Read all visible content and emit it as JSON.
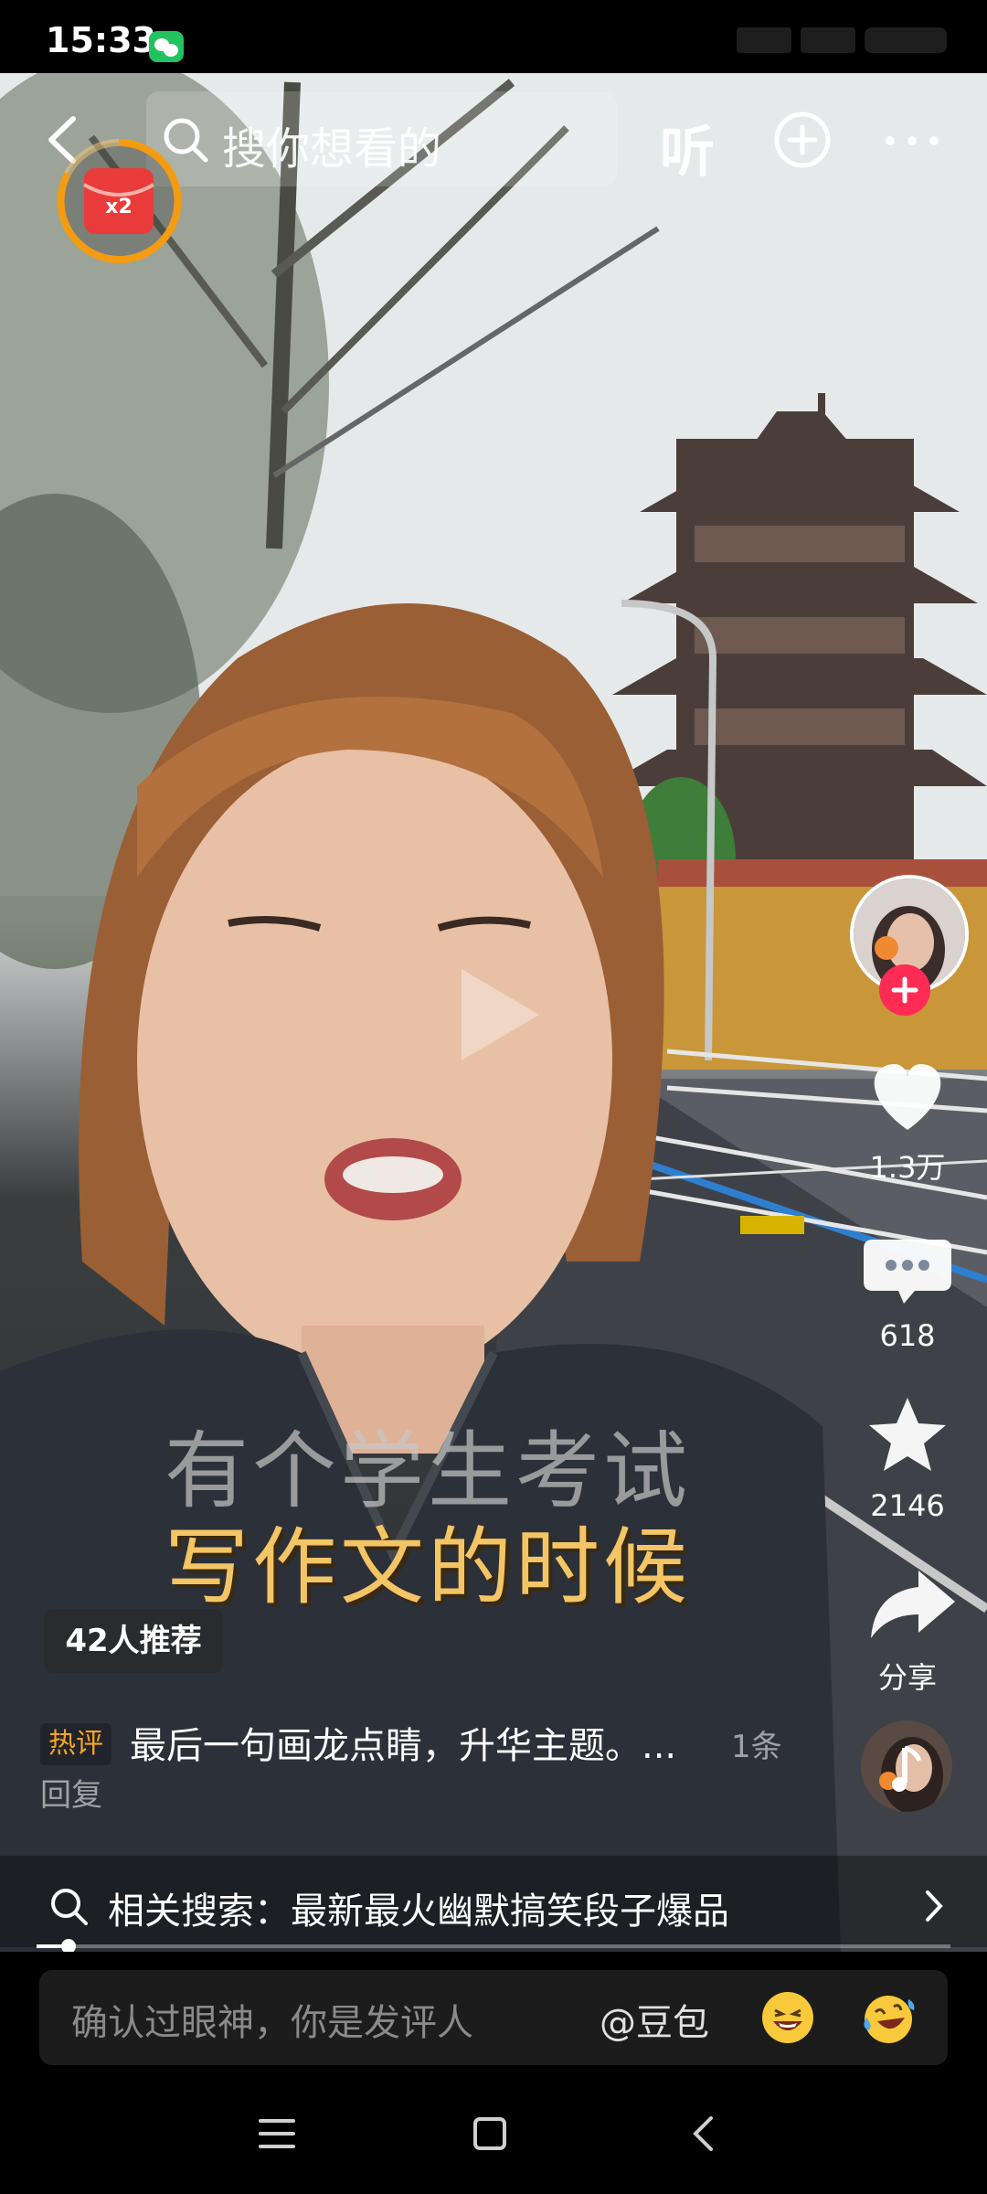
{
  "status_bar": {
    "time": "15:33"
  },
  "top_bar": {
    "search_placeholder": "搜你想看的",
    "listen_label": "听",
    "redpack_multiplier": "x2"
  },
  "caption": {
    "line1": "有个学生考试",
    "line2": "写作文的时候"
  },
  "actions": {
    "likes": "1.3万",
    "comments": "618",
    "favorites": "2146",
    "share_label": "分享"
  },
  "recommend_badge": "42人推荐",
  "hot_comment": {
    "tag": "热评",
    "text": "最后一句画龙点睛，升华主题。...",
    "reply_count": "1条",
    "reply_suffix": "回复"
  },
  "related_search": {
    "text": "相关搜索：最新最火幽默搞笑段子爆品"
  },
  "playback": {
    "progress": 0.035
  },
  "comment_bar": {
    "placeholder": "确认过眼神，你是发评人",
    "mention": "@豆包"
  }
}
